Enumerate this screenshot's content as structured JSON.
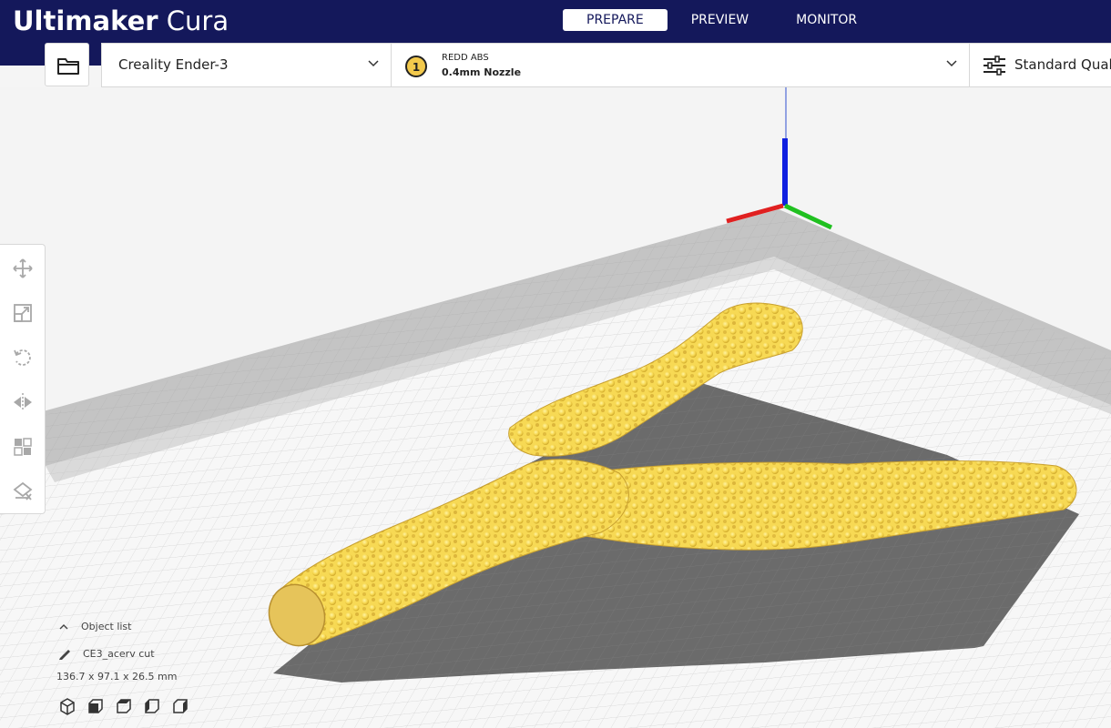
{
  "app": {
    "brand_bold": "Ultimaker",
    "brand_light": " Cura"
  },
  "stages": [
    {
      "label": "PREPARE",
      "active": true
    },
    {
      "label": "PREVIEW",
      "active": false
    },
    {
      "label": "MONITOR",
      "active": false
    }
  ],
  "toolbar": {
    "open_icon": "folder-icon",
    "printer": "Creality Ender-3",
    "extruder_number": "1",
    "material": "REDD ABS",
    "nozzle": "0.4mm Nozzle",
    "quality": "Standard Quality"
  },
  "tools": [
    {
      "name": "move-tool",
      "icon": "move-icon"
    },
    {
      "name": "scale-tool",
      "icon": "scale-icon"
    },
    {
      "name": "rotate-tool",
      "icon": "rotate-icon"
    },
    {
      "name": "mirror-tool",
      "icon": "mirror-icon"
    },
    {
      "name": "per-model-settings-tool",
      "icon": "per-model-settings-icon"
    },
    {
      "name": "support-blocker-tool",
      "icon": "support-blocker-icon"
    }
  ],
  "object_list": {
    "toggle_label": "Object list",
    "object_name": "CE3_acerv cut",
    "dimensions": "136.7 x 97.1 x 26.5 mm"
  },
  "colors": {
    "header": "#14185b",
    "model": "#f9dc5c",
    "shadow": "#6b6b6b",
    "axis_x": "#e02020",
    "axis_y": "#20c020",
    "axis_z": "#1020e0"
  }
}
